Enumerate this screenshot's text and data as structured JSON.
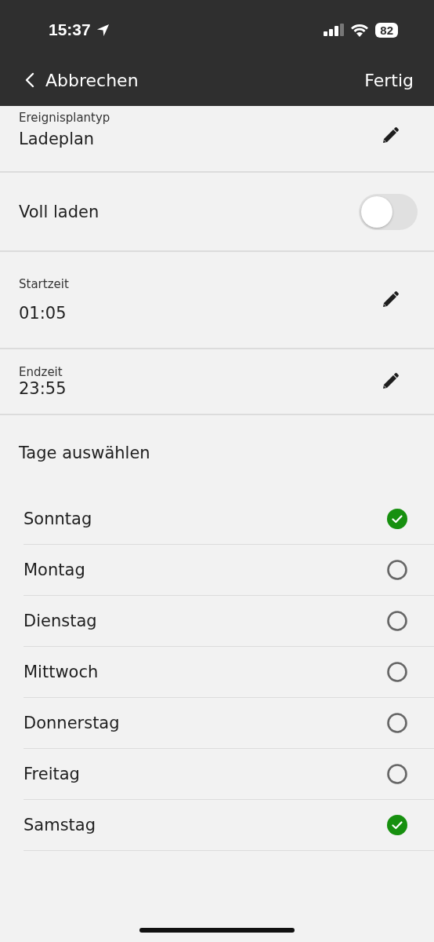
{
  "status_bar": {
    "time": "15:37",
    "battery": "82"
  },
  "nav": {
    "back": "Abbrechen",
    "done": "Fertig"
  },
  "fields": [
    {
      "kind": "edit",
      "label": "Ereignisplantyp",
      "value": "Ladeplan"
    },
    {
      "kind": "toggle",
      "label": "Voll laden",
      "on": false
    },
    {
      "kind": "edit",
      "label": "Startzeit",
      "value": "01:05"
    },
    {
      "kind": "edit",
      "label": "Endzeit",
      "value": "23:55"
    }
  ],
  "days_title": "Tage auswählen",
  "days": [
    {
      "label": "Sonntag",
      "checked": true
    },
    {
      "label": "Montag",
      "checked": false
    },
    {
      "label": "Dienstag",
      "checked": false
    },
    {
      "label": "Mittwoch",
      "checked": false
    },
    {
      "label": "Donnerstag",
      "checked": false
    },
    {
      "label": "Freitag",
      "checked": false
    },
    {
      "label": "Samstag",
      "checked": true
    }
  ]
}
